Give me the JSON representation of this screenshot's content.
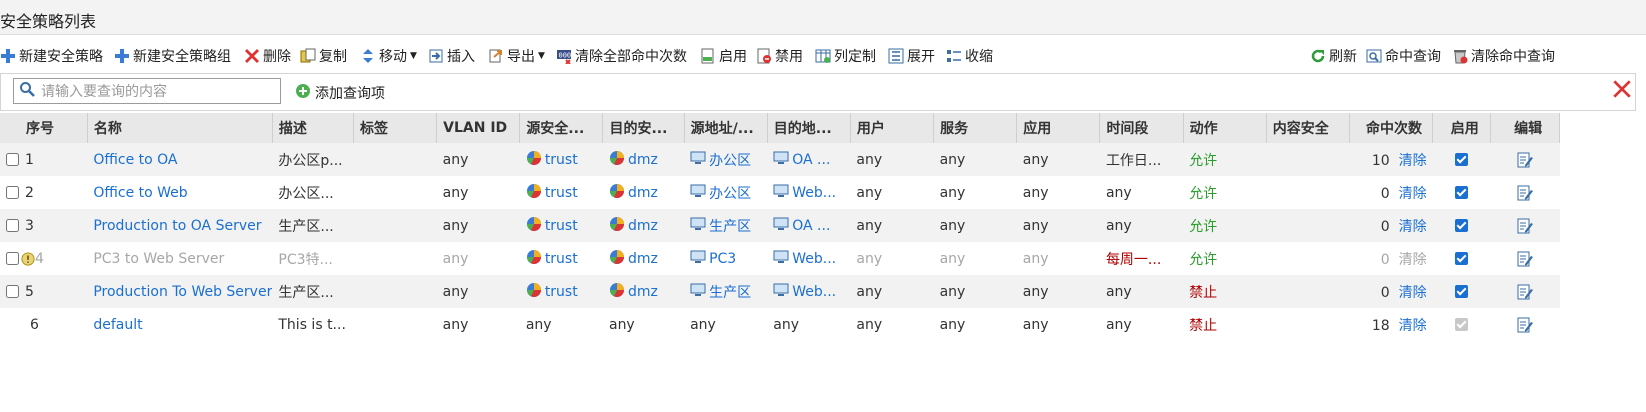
{
  "page": {
    "title": "安全策略列表"
  },
  "toolbar": {
    "new_policy": "新建安全策略",
    "new_group": "新建安全策略组",
    "delete": "删除",
    "copy": "复制",
    "move": "移动",
    "insert": "插入",
    "export": "导出",
    "clear_all_hits": "清除全部命中次数",
    "enable": "启用",
    "disable": "禁用",
    "customize_columns": "列定制",
    "expand": "展开",
    "collapse": "收缩",
    "refresh": "刷新",
    "hit_query": "命中查询",
    "clear_hit_query": "清除命中查询"
  },
  "search": {
    "placeholder": "请输入要查询的内容",
    "add_query": "添加查询项"
  },
  "table": {
    "headers": [
      "序号",
      "名称",
      "描述",
      "标签",
      "VLAN ID",
      "源安全...",
      "目的安...",
      "源地址/...",
      "目的地...",
      "用户",
      "服务",
      "应用",
      "时间段",
      "动作",
      "内容安全",
      "命中次数",
      "启用",
      "编辑"
    ],
    "rows": [
      {
        "seq": "1",
        "name": "Office to OA",
        "desc": "办公区p...",
        "tag": "",
        "vlan": "any",
        "src_zone": "trust",
        "dst_zone": "dmz",
        "src_addr": "办公区",
        "dst_addr": "OA ...",
        "user": "any",
        "service": "any",
        "app": "any",
        "schedule": "工作日...",
        "action": "允许",
        "content": "",
        "hits": "10",
        "clear": "清除",
        "enabled": true
      },
      {
        "seq": "2",
        "name": "Office to Web",
        "desc": "办公区...",
        "tag": "",
        "vlan": "any",
        "src_zone": "trust",
        "dst_zone": "dmz",
        "src_addr": "办公区",
        "dst_addr": "Web...",
        "user": "any",
        "service": "any",
        "app": "any",
        "schedule": "any",
        "action": "允许",
        "content": "",
        "hits": "0",
        "clear": "清除",
        "enabled": true
      },
      {
        "seq": "3",
        "name": "Production to OA Server",
        "desc": "生产区...",
        "tag": "",
        "vlan": "any",
        "src_zone": "trust",
        "dst_zone": "dmz",
        "src_addr": "生产区",
        "dst_addr": "OA ...",
        "user": "any",
        "service": "any",
        "app": "any",
        "schedule": "any",
        "action": "允许",
        "content": "",
        "hits": "0",
        "clear": "清除",
        "enabled": true
      },
      {
        "seq": "4",
        "name": "PC3 to Web Server",
        "desc": "PC3特...",
        "tag": "",
        "vlan": "any",
        "src_zone": "trust",
        "dst_zone": "dmz",
        "src_addr": "PC3",
        "dst_addr": "Web...",
        "user": "any",
        "service": "any",
        "app": "any",
        "schedule": "每周一...",
        "action": "允许",
        "content": "",
        "hits": "0",
        "clear": "清除",
        "enabled": true
      },
      {
        "seq": "5",
        "name": "Production To Web Server",
        "desc": "生产区...",
        "tag": "",
        "vlan": "any",
        "src_zone": "trust",
        "dst_zone": "dmz",
        "src_addr": "生产区",
        "dst_addr": "Web...",
        "user": "any",
        "service": "any",
        "app": "any",
        "schedule": "any",
        "action": "禁止",
        "content": "",
        "hits": "0",
        "clear": "清除",
        "enabled": true
      },
      {
        "seq": "6",
        "name": "default",
        "desc": "This is t...",
        "tag": "",
        "vlan": "any",
        "src_zone": "any",
        "dst_zone": "any",
        "src_addr": "any",
        "dst_addr": "any",
        "user": "any",
        "service": "any",
        "app": "any",
        "schedule": "any",
        "action": "禁止",
        "content": "",
        "hits": "18",
        "clear": "清除",
        "enabled": true
      }
    ]
  },
  "colors": {
    "link": "#1a6fd1",
    "allow": "#2a9d2a",
    "deny": "#b00000",
    "header_bg": "#e8e8e8",
    "row_alt": "#f2f2f2"
  }
}
